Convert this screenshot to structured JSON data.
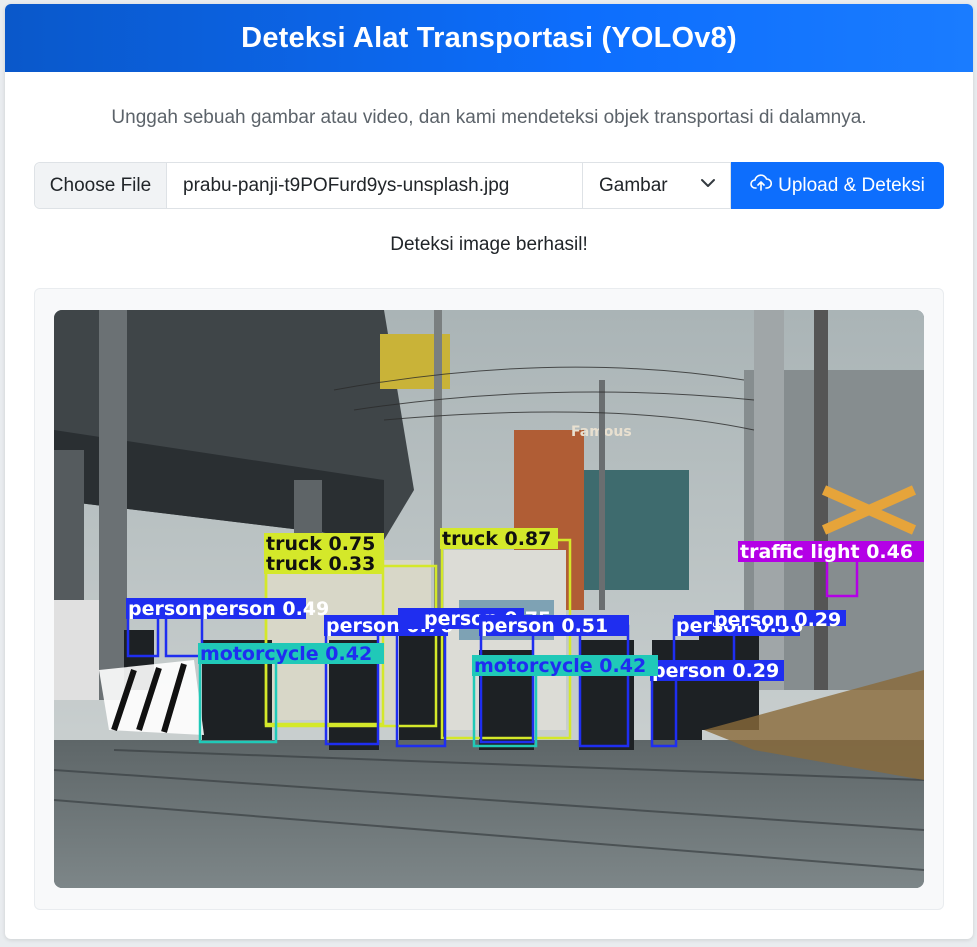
{
  "header": {
    "title": "Deteksi Alat Transportasi (YOLOv8)"
  },
  "subtitle": "Unggah sebuah gambar atau video, dan kami mendeteksi objek transportasi di dalamnya.",
  "form": {
    "choose_file_label": "Choose File",
    "file_name": "prabu-panji-t9POFurd9ys-unsplash.jpg",
    "type_selected": "Gambar",
    "upload_label": "Upload & Deteksi"
  },
  "status_message": "Deteksi image berhasil!",
  "result": {
    "sign_text": "Famous",
    "detections": [
      {
        "label": "truck 0.75",
        "color": "#d4e82a"
      },
      {
        "label": "truck 0.33",
        "color": "#d4e82a"
      },
      {
        "label": "truck 0.87",
        "color": "#d4e82a"
      },
      {
        "label": "traffic light 0.46",
        "color": "#b400e6"
      },
      {
        "label": "person 0.53",
        "color": "#1f2ef0"
      },
      {
        "label": "person 0.49",
        "color": "#1f2ef0"
      },
      {
        "label": "person 0.76",
        "color": "#1f2ef0"
      },
      {
        "label": "person 0.75",
        "color": "#1f2ef0"
      },
      {
        "label": "person 0.51",
        "color": "#1f2ef0"
      },
      {
        "label": "person 0.56",
        "color": "#1f2ef0"
      },
      {
        "label": "person 0.29",
        "color": "#1f2ef0"
      },
      {
        "label": "person 0.29",
        "color": "#1f2ef0"
      },
      {
        "label": "motorcycle 0.42",
        "color": "#20c9b8"
      },
      {
        "label": "motorcycle 0.42",
        "color": "#20c9b8"
      }
    ]
  },
  "colors": {
    "primary": "#0d6efd",
    "header_start": "#0a58ca"
  }
}
